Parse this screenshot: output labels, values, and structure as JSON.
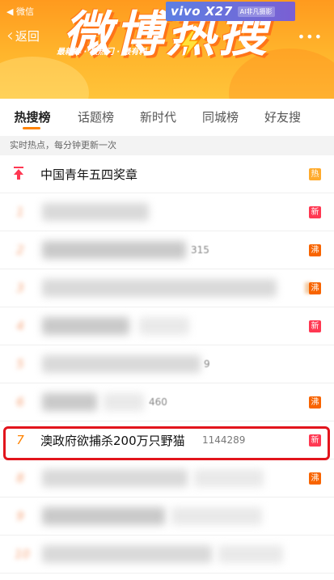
{
  "status": {
    "back_app": "◀ 微信"
  },
  "header": {
    "back_label": "返回",
    "more_label": "•••",
    "title": "微博热搜",
    "slogan": "最新鲜 · 最热门 · 最有料",
    "ad": {
      "brand": "vivo X27",
      "sub": "AI非凡摄影"
    },
    "colors": {
      "banner": "#ffb52c",
      "accent": "#ff8200"
    }
  },
  "tabs": [
    {
      "label": "热搜榜",
      "active": true
    },
    {
      "label": "话题榜",
      "active": false
    },
    {
      "label": "新时代",
      "active": false
    },
    {
      "label": "同城榜",
      "active": false
    },
    {
      "label": "好友搜",
      "active": false
    }
  ],
  "subtitle": "实时热点，每分钟更新一次",
  "list": [
    {
      "rank": "",
      "pinned": true,
      "topic": "中国青年五四奖章",
      "heat": "",
      "badge": "热"
    },
    {
      "rank": "1",
      "topic": "",
      "heat": "",
      "badge": "新"
    },
    {
      "rank": "2",
      "topic": "",
      "heat": "315",
      "badge": "沸"
    },
    {
      "rank": "3",
      "topic": "",
      "heat": "",
      "badge": "沸"
    },
    {
      "rank": "4",
      "topic": "",
      "heat": "",
      "badge": "新"
    },
    {
      "rank": "5",
      "topic": "",
      "heat": "9",
      "badge": ""
    },
    {
      "rank": "6",
      "topic": "",
      "heat": "460",
      "badge": "沸"
    },
    {
      "rank": "7",
      "topic": "澳政府欲捕杀200万只野猫",
      "heat": "1144289",
      "badge": "新"
    },
    {
      "rank": "8",
      "topic": "",
      "heat": "",
      "badge": "沸"
    },
    {
      "rank": "9",
      "topic": "",
      "heat": "",
      "badge": ""
    },
    {
      "rank": "10",
      "topic": "",
      "heat": "",
      "badge": ""
    }
  ]
}
